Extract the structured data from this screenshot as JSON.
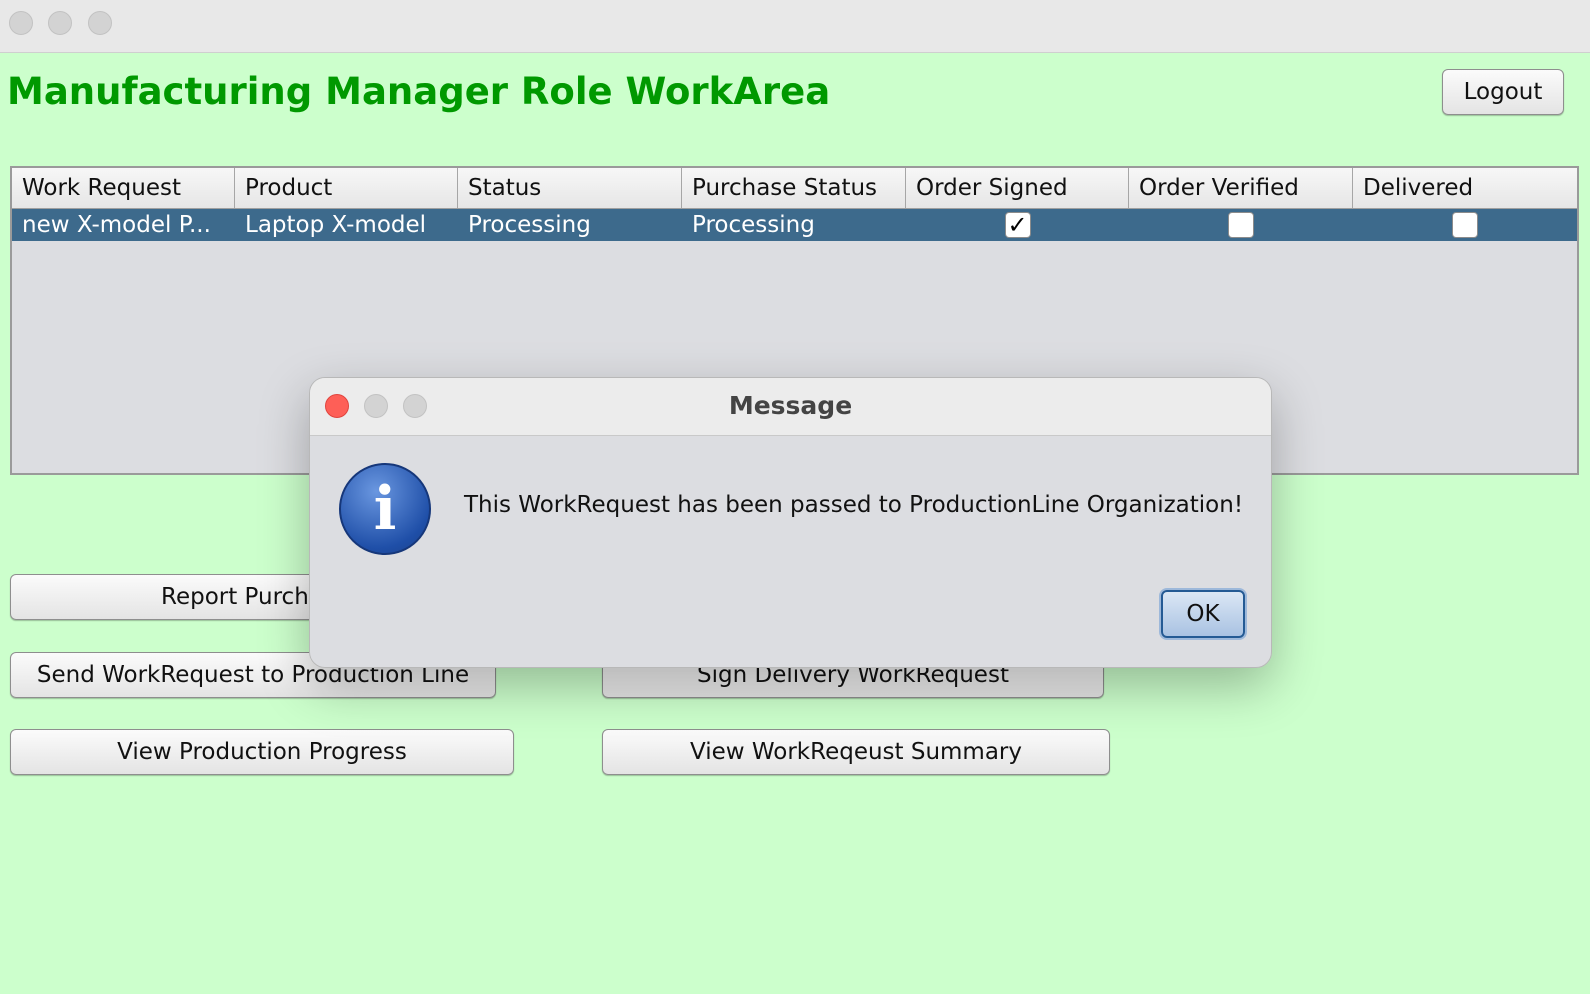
{
  "window": {
    "title_bar_buttons": [
      "close",
      "minimize",
      "zoom"
    ]
  },
  "header": {
    "title": "Manufacturing Manager Role WorkArea",
    "logout_label": "Logout"
  },
  "table": {
    "columns": [
      "Work Request",
      "Product",
      "Status",
      "Purchase Status",
      "Order Signed",
      "Order Verified",
      "Delivered"
    ],
    "rows": [
      {
        "work_request": "new X-model P...",
        "product": "Laptop X-model",
        "status": "Processing",
        "purchase_status": "Processing",
        "order_signed": true,
        "order_verified": false,
        "delivered": false
      }
    ],
    "checkmark": "✓"
  },
  "actions": {
    "report_purchase": "Report Purchase",
    "send_to_production": "Send WorkRequest to Production Line",
    "sign_delivery": "Sign Delivery WorkRequest",
    "view_production": "View Production Progress",
    "view_summary": "View WorkReqeust Summary"
  },
  "dialog": {
    "title": "Message",
    "icon": "info-icon",
    "icon_glyph": "i",
    "message": "This WorkRequest has been passed to ProductionLine Organization!",
    "ok_label": "OK"
  },
  "colors": {
    "background": "#ccffcc",
    "title_green": "#009900",
    "selected_row": "#3d6a8c",
    "close_red": "#fe5f57"
  }
}
